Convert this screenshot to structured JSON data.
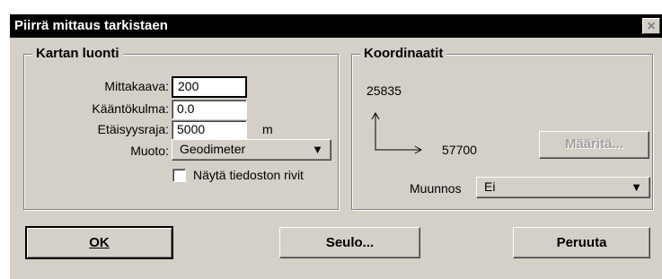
{
  "window": {
    "title": "Piirrä mittaus tarkistaen",
    "close_glyph": "×"
  },
  "kartan_luonti": {
    "legend": "Kartan luonti",
    "mittakaava": {
      "label": "Mittakaava:",
      "value": "200"
    },
    "kaantokulma": {
      "label": "Kääntökulma:",
      "value": "0.0"
    },
    "etaisyysraja": {
      "label": "Etäisyysraja:",
      "value": "5000",
      "unit": "m"
    },
    "muoto": {
      "label": "Muoto:",
      "value": "Geodimeter"
    },
    "nayta_rivit": {
      "label": "Näytä tiedoston rivit",
      "checked": false
    }
  },
  "koordinaatit": {
    "legend": "Koordinaatit",
    "y_value": "25835",
    "x_value": "57700",
    "maarita_button": "Määritä...",
    "muunnos": {
      "label": "Muunnos",
      "value": "Ei"
    }
  },
  "buttons": {
    "ok": "OK",
    "seulo": "Seulo...",
    "peruuta": "Peruuta"
  }
}
